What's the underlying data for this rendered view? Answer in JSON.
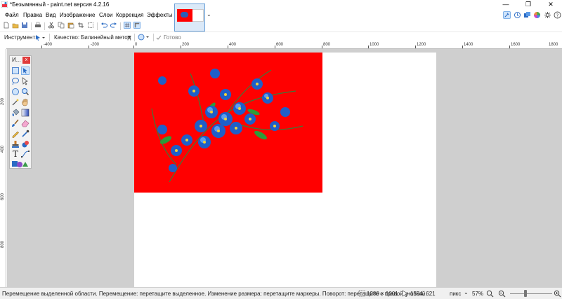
{
  "window": {
    "title": "*Безымянный - paint.net версия 4.2.16",
    "minimize": "—",
    "maximize": "❐",
    "close": "✕"
  },
  "menu": {
    "items": [
      "Файл",
      "Правка",
      "Вид",
      "Изображение",
      "Слои",
      "Коррекция",
      "Эффекты"
    ]
  },
  "tab": {
    "dropdown": "⌄"
  },
  "options": {
    "tool_label": "Инструмент:",
    "quality_label": "Качество:",
    "quality_value": "Билинейный метод",
    "done_label": "Готово"
  },
  "ruler": {
    "top_labels": [
      "-400",
      "-200",
      "0",
      "200",
      "400",
      "600",
      "800",
      "1000",
      "1200",
      "1400",
      "1600",
      "1800"
    ],
    "left_labels": [
      "200",
      "400",
      "600",
      "800"
    ]
  },
  "tools_panel": {
    "title": "И...",
    "close": "x",
    "text_tool_glyph": "T"
  },
  "status": {
    "hint": "Перемещение выделенной области. Перемещение: перетащите выделенное. Изменение размера: перетащите маркеры. Поворот: перетащите с правой кнопкой.",
    "image_size": "1280 × 1001",
    "cursor_pos": "1554, 621",
    "units": "пикс",
    "zoom": "57%",
    "units_dropdown": "⌄"
  },
  "colors": {
    "canvas_fill": "#ff0000",
    "workspace": "#cfcfcf",
    "accent": "#2a7ad8"
  }
}
